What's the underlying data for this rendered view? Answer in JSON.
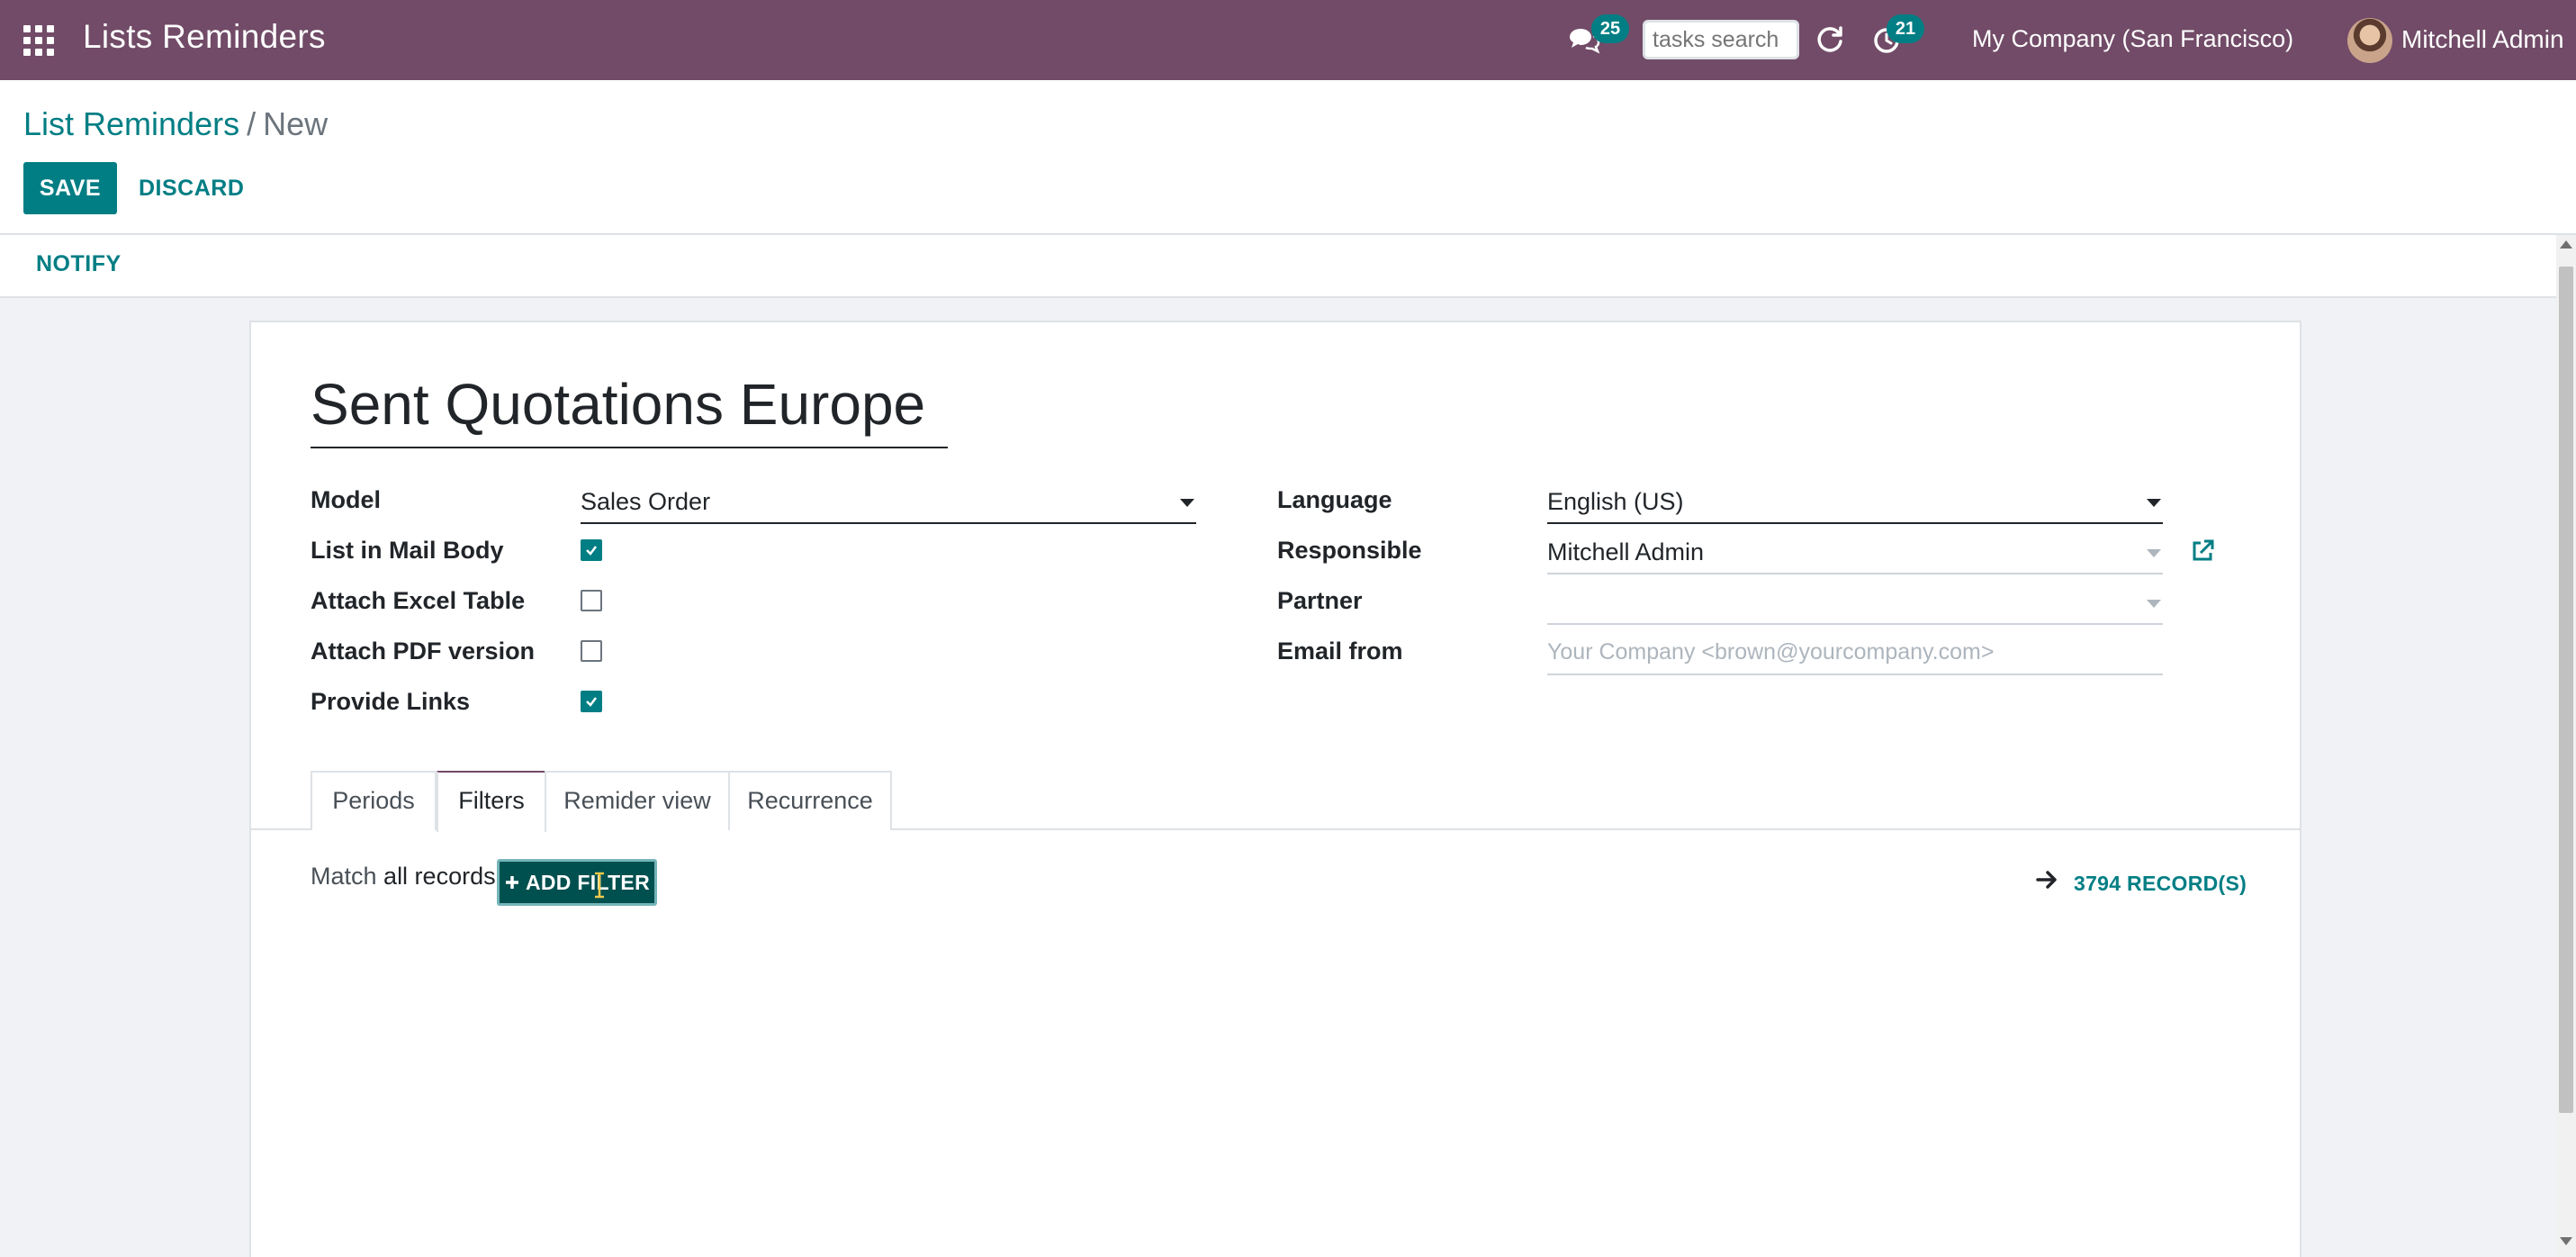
{
  "navbar": {
    "app_title": "Lists Reminders",
    "messages_count": "25",
    "search_placeholder": "tasks search",
    "activities_count": "21",
    "company": "My Company (San Francisco)",
    "user_name": "Mitchell Admin",
    "icons": [
      "apps-grid-icon",
      "chat-icon",
      "refresh-icon",
      "activity-clock-icon"
    ]
  },
  "breadcrumb": {
    "parent": "List Reminders",
    "separator": "/",
    "current": "New"
  },
  "buttons": {
    "save": "SAVE",
    "discard": "DISCARD",
    "notify": "NOTIFY"
  },
  "form": {
    "name": "Sent Quotations Europe",
    "left_fields": [
      {
        "label": "Model",
        "value": "Sales Order"
      },
      {
        "label": "List in Mail Body",
        "checked": true
      },
      {
        "label": "Attach Excel Table",
        "checked": false
      },
      {
        "label": "Attach PDF version",
        "checked": false
      },
      {
        "label": "Provide Links",
        "checked": true
      }
    ],
    "right_fields": [
      {
        "label": "Language",
        "value": "English (US)"
      },
      {
        "label": "Responsible",
        "value": "Mitchell Admin"
      },
      {
        "label": "Partner",
        "value": ""
      },
      {
        "label": "Email from",
        "placeholder": "Your Company <brown@yourcompany.com>"
      }
    ]
  },
  "tabs": [
    {
      "label": "Periods",
      "active": false
    },
    {
      "label": "Filters",
      "active": true
    },
    {
      "label": "Remider view",
      "active": false
    },
    {
      "label": "Recurrence",
      "active": false
    }
  ],
  "filters": {
    "match_prefix": "Match",
    "match_all": "all records",
    "add_filter": "ADD FILTER",
    "records_count": "3794 RECORD(S)"
  },
  "colors": {
    "navbar": "#714b67",
    "primary": "#017e84",
    "add_filter_bg": "#00504f"
  }
}
